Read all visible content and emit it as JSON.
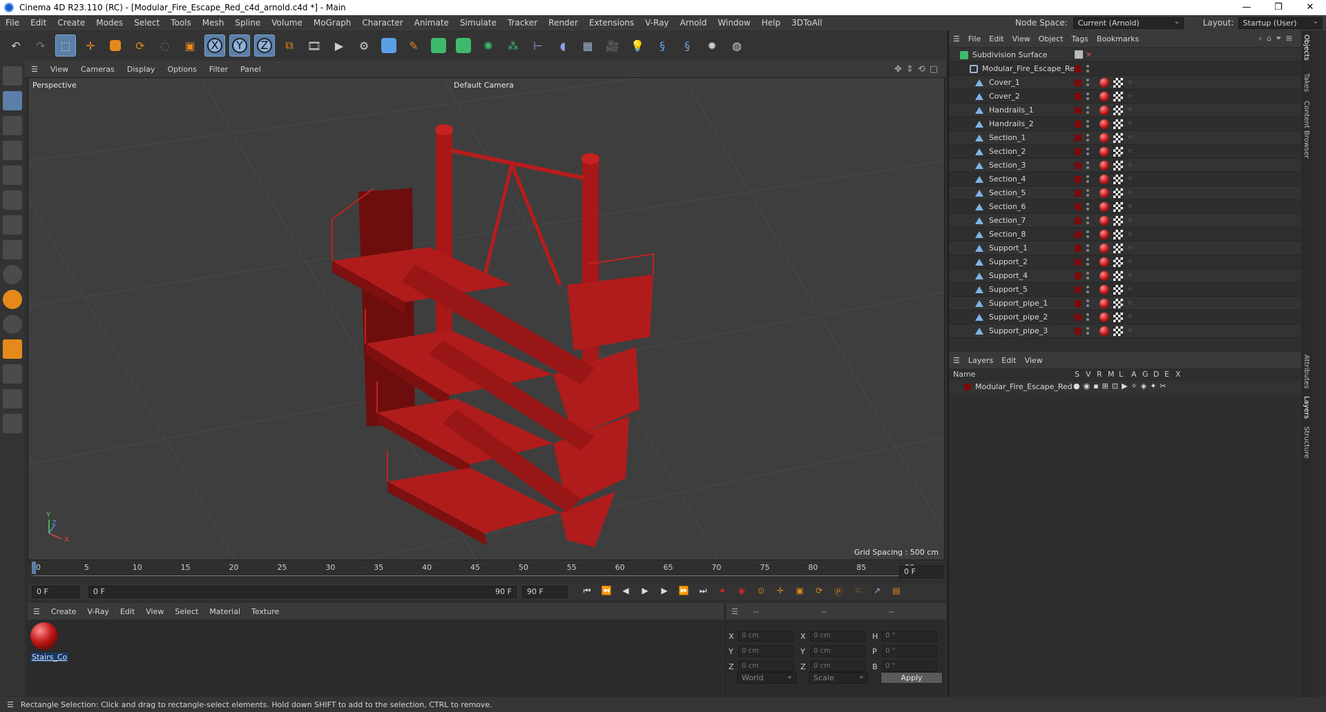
{
  "window": {
    "title": "Cinema 4D R23.110 (RC) - [Modular_Fire_Escape_Red_c4d_arnold.c4d *] - Main",
    "controls": [
      "—",
      "❐",
      "✕"
    ]
  },
  "menubar": {
    "items": [
      "File",
      "Edit",
      "Create",
      "Modes",
      "Select",
      "Tools",
      "Mesh",
      "Spline",
      "Volume",
      "MoGraph",
      "Character",
      "Animate",
      "Simulate",
      "Tracker",
      "Render",
      "Extensions",
      "V-Ray",
      "Arnold",
      "Window",
      "Help",
      "3DToAll"
    ],
    "node_space_label": "Node Space:",
    "node_space_value": "Current (Arnold)",
    "layout_label": "Layout:",
    "layout_value": "Startup (User)"
  },
  "toolbar": {
    "icons": [
      "undo-icon",
      "redo-icon",
      "select-icon",
      "move-icon",
      "scale-icon",
      "rotate-icon",
      "recent-icon",
      "rect-select-icon",
      "x-axis-icon",
      "y-axis-icon",
      "z-axis-icon",
      "coord-system-icon",
      "render-view-icon",
      "render-active-icon",
      "render-settings-icon",
      "cube-icon",
      "pen-icon",
      "subdivision-icon",
      "extrude-icon",
      "mograph-icon",
      "cloner-icon",
      "field-icon",
      "deformer-icon",
      "floor-icon",
      "camera-icon",
      "light-icon",
      "python-icon",
      "python2-icon",
      "gear-icon",
      "globe-icon"
    ],
    "axis_labels": [
      "X",
      "Y",
      "Z"
    ]
  },
  "viewport": {
    "menu": [
      "View",
      "Cameras",
      "Display",
      "Options",
      "Filter",
      "Panel"
    ],
    "label": "Perspective",
    "camera": "Default Camera",
    "grid_spacing": "Grid Spacing : 500 cm",
    "axis_y": "Y",
    "axis_z": "Z",
    "axis_x": "X"
  },
  "timeline": {
    "ticks": [
      "0",
      "5",
      "10",
      "15",
      "20",
      "25",
      "30",
      "35",
      "40",
      "45",
      "50",
      "55",
      "60",
      "65",
      "70",
      "75",
      "80",
      "85",
      "90"
    ],
    "current_frame": "0 F",
    "start_frame": "0 F",
    "range_start": "0 F",
    "range_end": "90 F",
    "end_frame": "90 F"
  },
  "material_manager": {
    "menu": [
      "Create",
      "V-Ray",
      "Edit",
      "View",
      "Select",
      "Material",
      "Texture"
    ],
    "material_name": "Stairs_Co"
  },
  "coordinates": {
    "header": [
      "--",
      "--",
      "--"
    ],
    "rows": [
      {
        "a": "X",
        "av": "0 cm",
        "b": "X",
        "bv": "0 cm",
        "c": "H",
        "cv": "0 °"
      },
      {
        "a": "Y",
        "av": "0 cm",
        "b": "Y",
        "bv": "0 cm",
        "c": "P",
        "cv": "0 °"
      },
      {
        "a": "Z",
        "av": "0 cm",
        "b": "Z",
        "bv": "0 cm",
        "c": "B",
        "cv": "0 °"
      }
    ],
    "space": "World",
    "mode": "Scale",
    "apply_label": "Apply"
  },
  "objects": {
    "menu": [
      "File",
      "Edit",
      "View",
      "Object",
      "Tags",
      "Bookmarks"
    ],
    "root": "Subdivision Surface",
    "group": "Modular_Fire_Escape_Red",
    "items": [
      "Cover_1",
      "Cover_2",
      "Handrails_1",
      "Handrails_2",
      "Section_1",
      "Section_2",
      "Section_3",
      "Section_4",
      "Section_5",
      "Section_6",
      "Section_7",
      "Section_8",
      "Support_1",
      "Support_2",
      "Support_4",
      "Support_5",
      "Support_pipe_1",
      "Support_pipe_2",
      "Support_pipe_3"
    ]
  },
  "layers": {
    "menu": [
      "Layers",
      "Edit",
      "View"
    ],
    "columns": [
      "Name",
      "S",
      "V",
      "R",
      "M",
      "L",
      "A",
      "G",
      "D",
      "E",
      "X"
    ],
    "row_name": "Modular_Fire_Escape_Red"
  },
  "side_tabs": [
    "Objects",
    "Takes",
    "Content Browser",
    "Attributes",
    "Layers",
    "Structure"
  ],
  "status": "Rectangle Selection: Click and drag to rectangle-select elements. Hold down SHIFT to add to the selection, CTRL to remove.",
  "colors": {
    "accent": "#5b7fa8",
    "model_red": "#b81c1c",
    "layer_color": "#7a0b0b"
  }
}
